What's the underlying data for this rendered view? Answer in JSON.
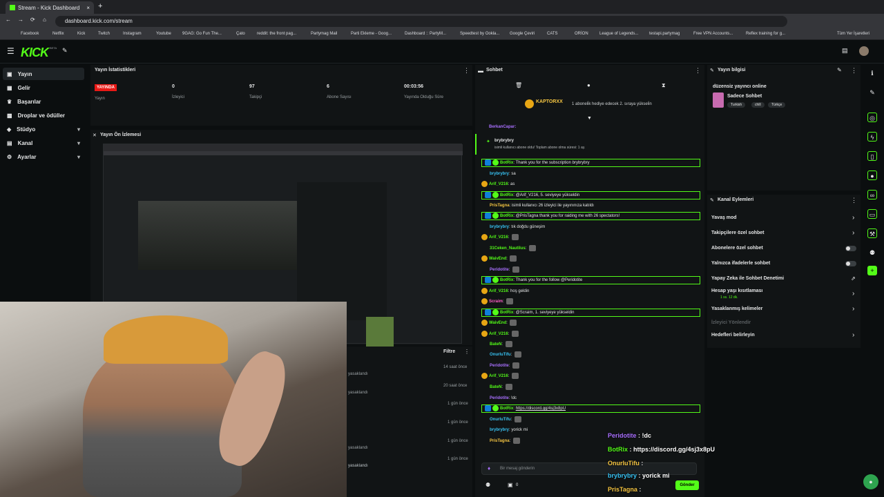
{
  "browser": {
    "tab_title": "Stream - Kick Dashboard",
    "url": "dashboard.kick.com/stream",
    "bookmarks": [
      "Facebook",
      "Netflix",
      "Kick",
      "Twitch",
      "Instagram",
      "Youtube",
      "9GAG: Go Fun The...",
      "Çato",
      "reddit: the front pag...",
      "Partymag Mail",
      "Parti Ekleme - Goog...",
      "Dashboard :: PartyM...",
      "Speedtest by Ookla...",
      "Google Çeviri",
      "CATS",
      "ORİON",
      "League of Legends...",
      "testapi.partymag",
      "Free VPN Accounts...",
      "Reflex training for g...",
      "Tüm Yer İşaretleri"
    ]
  },
  "header": {
    "logo": "KICK",
    "beta": "BETA"
  },
  "sidebar": {
    "items": [
      {
        "label": "Yayın"
      },
      {
        "label": "Gelir"
      },
      {
        "label": "Başarılar"
      },
      {
        "label": "Droplar ve ödüller"
      },
      {
        "label": "Stüdyo"
      },
      {
        "label": "Kanal"
      },
      {
        "label": "Ayarlar"
      }
    ]
  },
  "stats": {
    "title": "Yayın İstatistikleri",
    "live_badge": "YAYINDA",
    "items": [
      {
        "value": "",
        "label": "Yayın"
      },
      {
        "value": "0",
        "label": "İzleyici"
      },
      {
        "value": "97",
        "label": "Takipçi"
      },
      {
        "value": "6",
        "label": "Abone Sayısı"
      },
      {
        "value": "00:03:56",
        "label": "Yayında Olduğu Süre"
      }
    ]
  },
  "preview": {
    "title": "Yayın Ön İzlemesi"
  },
  "events": {
    "filter": "Filtre",
    "rows": [
      {
        "text": "yasaklandı",
        "time": "14 saat önce"
      },
      {
        "text": "yasaklandı",
        "time": "20 saat önce"
      },
      {
        "text": "",
        "time": "1 gün önce"
      },
      {
        "text": "",
        "time": "1 gün önce"
      },
      {
        "text": "yasaklandı",
        "time": "1 gün önce"
      },
      {
        "text": "yasaklandı",
        "time": "1 gün önce"
      },
      {
        "text": "yasaklandı",
        "time": ""
      }
    ]
  },
  "chat": {
    "title": "Sohbet",
    "pinned_user": "KAPTORXX",
    "pinned_text": "1 aboneli̇k hediye edecek 2. sıraya yükseli̇n",
    "sub_user": "brybrybry",
    "sub_text": "isimli kullanıcı abone oldu! Toplam abone olma süresi: 1 ay.",
    "first_user": "BerkanCapar:",
    "messages": [
      {
        "user": "BotRix",
        "text": "Thank you for the subscription brybrybry",
        "bot": true
      },
      {
        "user": "brybrybry",
        "text": "sa",
        "bot": false
      },
      {
        "user": "Arif_V216",
        "text": "as",
        "bot": false
      },
      {
        "user": "BotRix",
        "text": "@Arif_V216, 5. seviyeye yükseldin",
        "bot": true
      },
      {
        "user": "PrisTagna",
        "text": "isimli kullanıcı 26 izleyici ile yayınınıza katıldı",
        "bot": false
      },
      {
        "user": "BotRix",
        "text": "@PrisTagna thank you for raiding me with 26 spectators!",
        "bot": true
      },
      {
        "user": "brybrybry",
        "text": "tık doğdu güneşim",
        "bot": false
      },
      {
        "user": "Arif_V216",
        "text": "",
        "bot": false
      },
      {
        "user": "31Ceken_Nautilus",
        "text": "",
        "bot": false
      },
      {
        "user": "WaivEnd",
        "text": "",
        "bot": false
      },
      {
        "user": "Peridotite",
        "text": "",
        "bot": false
      },
      {
        "user": "BotRix",
        "text": "Thank you for the follow @Peridotite",
        "bot": true
      },
      {
        "user": "Arif_V216",
        "text": "hoş geldin",
        "bot": false
      },
      {
        "user": "Scraim",
        "text": "",
        "bot": false
      },
      {
        "user": "BotRix",
        "text": "@Scraim, 1. seviyeye yükseldin",
        "bot": true
      },
      {
        "user": "WaivEnd",
        "text": "",
        "bot": false
      },
      {
        "user": "Arif_V216",
        "text": "",
        "bot": false
      },
      {
        "user": "BateN",
        "text": "",
        "bot": false
      },
      {
        "user": "OnurluTifu",
        "text": "",
        "bot": false
      },
      {
        "user": "Peridotite",
        "text": "",
        "bot": false
      },
      {
        "user": "Arif_V216",
        "text": "",
        "bot": false
      },
      {
        "user": "BateN",
        "text": "",
        "bot": false
      },
      {
        "user": "Peridotite",
        "text": "!dc",
        "bot": false
      },
      {
        "user": "BotRix",
        "text": "https://discord.gg/4sj3x8pU",
        "bot": true
      },
      {
        "user": "OnurluTifu",
        "text": "",
        "bot": false
      },
      {
        "user": "brybrybry",
        "text": "yorick mi",
        "bot": false
      },
      {
        "user": "PrisTagna",
        "text": "",
        "bot": false
      }
    ],
    "input_placeholder": "Bir mesaj gönderin",
    "count": "0",
    "send": "Gönder"
  },
  "overlay": [
    {
      "user": "Peridotite",
      "text": "!dc"
    },
    {
      "user": "BotRix",
      "text": "https://discord.gg/4sj3x8pU"
    },
    {
      "user": "OnurluTifu",
      "text": ""
    },
    {
      "user": "brybrybry",
      "text": "yorick mi"
    },
    {
      "user": "PrisTagna",
      "text": ""
    }
  ],
  "info": {
    "title": "Yayın bilgisi",
    "stream_title": "düzensiz yayıncı online",
    "category": "Sadece Sohbet",
    "tags": [
      "Turkish",
      "chill",
      "Türkçe"
    ]
  },
  "actions": {
    "title": "Kanal Eylemleri",
    "items": [
      {
        "label": "Yavaş mod",
        "control": "chevron"
      },
      {
        "label": "Takipçilere özel sohbet",
        "control": "chevron"
      },
      {
        "label": "Abonelere özel sohbet",
        "control": "toggle"
      },
      {
        "label": "Yalnızca ifadelerle sohbet",
        "control": "toggle"
      },
      {
        "label": "Yapay Zeka ile Sohbet Denetimi",
        "control": "icon"
      },
      {
        "label": "Hesap yaşı kısıtlaması",
        "sub": "1 ss. 12 dk.",
        "control": "chevron"
      },
      {
        "label": "Yasaklanmış kelimeler",
        "control": "chevron"
      },
      {
        "label": "İzleyici Yönlendir",
        "control": "none"
      },
      {
        "label": "Hedefleri belirleyin",
        "control": "chevron"
      }
    ]
  },
  "colors": {
    "accent": "#53fc18",
    "live": "#e91916",
    "panel": "#111415",
    "bg": "#0b0e0f"
  }
}
